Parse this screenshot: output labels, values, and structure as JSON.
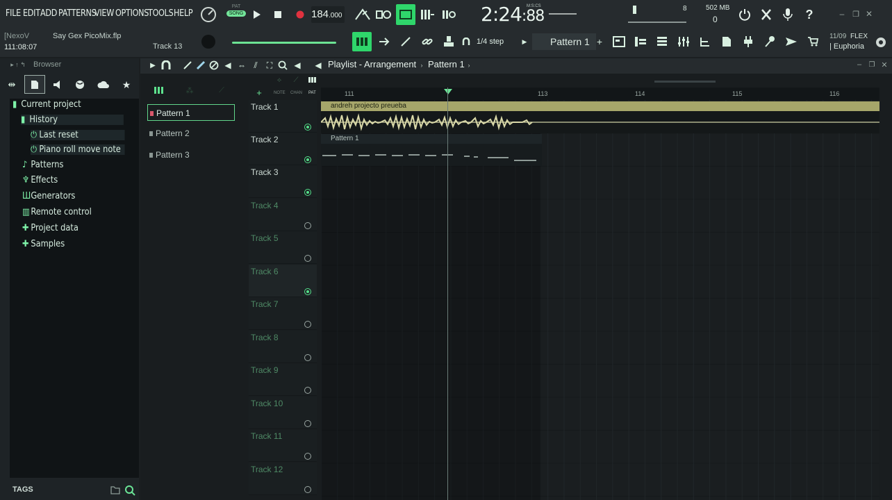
{
  "menu": [
    "FILE",
    "EDIT",
    "ADD",
    "PATTERNS",
    "VIEW",
    "OPTIONS",
    "TOOLS",
    "HELP"
  ],
  "transport": {
    "mode_pat": "PAT",
    "mode_song": "SONG",
    "tempo_int": "184",
    "tempo_dec": ".000",
    "time_main": "2:24",
    "time_sub": ":88",
    "time_label": "M:S:CS",
    "cpu": "8",
    "memory": "502 MB",
    "memory_count": "0"
  },
  "hint": {
    "user": "[NexoV",
    "project_file": "Say Gex PicoMix.flp",
    "clock": "111:08:07",
    "track": "Track 13"
  },
  "toolbar": {
    "step": "1/4 step",
    "pattern": "Pattern 1"
  },
  "flex": {
    "date": "11/09",
    "label": "FLEX",
    "preset": "| Euphoria"
  },
  "browser": {
    "title": "Browser",
    "tags": "TAGS",
    "items": [
      {
        "label": "Current project",
        "icon": "folder-icon"
      },
      {
        "label": "History",
        "icon": "folder-icon"
      },
      {
        "label": "Last reset",
        "icon": "power-icon"
      },
      {
        "label": "Piano roll move note",
        "icon": "power-icon"
      },
      {
        "label": "Patterns",
        "icon": "note-icon"
      },
      {
        "label": "Effects",
        "icon": "plug-icon"
      },
      {
        "label": "Generators",
        "icon": "piano-icon"
      },
      {
        "label": "Remote control",
        "icon": "remote-icon"
      },
      {
        "label": "Project data",
        "icon": "plus-icon"
      },
      {
        "label": "Samples",
        "icon": "plus-icon"
      }
    ]
  },
  "playlist": {
    "title": "Playlist - Arrangement",
    "pattern": "Pattern 1",
    "patterns": [
      "Pattern 1",
      "Pattern 2",
      "Pattern 3"
    ],
    "header_labels": [
      "NOTE",
      "CHAN",
      "PAT"
    ],
    "tracks": [
      "Track 1",
      "Track 2",
      "Track 3",
      "Track 4",
      "Track 5",
      "Track 6",
      "Track 7",
      "Track 8",
      "Track 9",
      "Track 10",
      "Track 11",
      "Track 12"
    ],
    "bars": [
      "111",
      "113",
      "114",
      "115",
      "116"
    ],
    "audio_clip": "andreh projecto preueba",
    "pattern_clip": "Pattern 1"
  },
  "colors": {
    "accent": "#2fd66b",
    "clip_audio": "#a6a66a",
    "background": "#1b1f21"
  }
}
